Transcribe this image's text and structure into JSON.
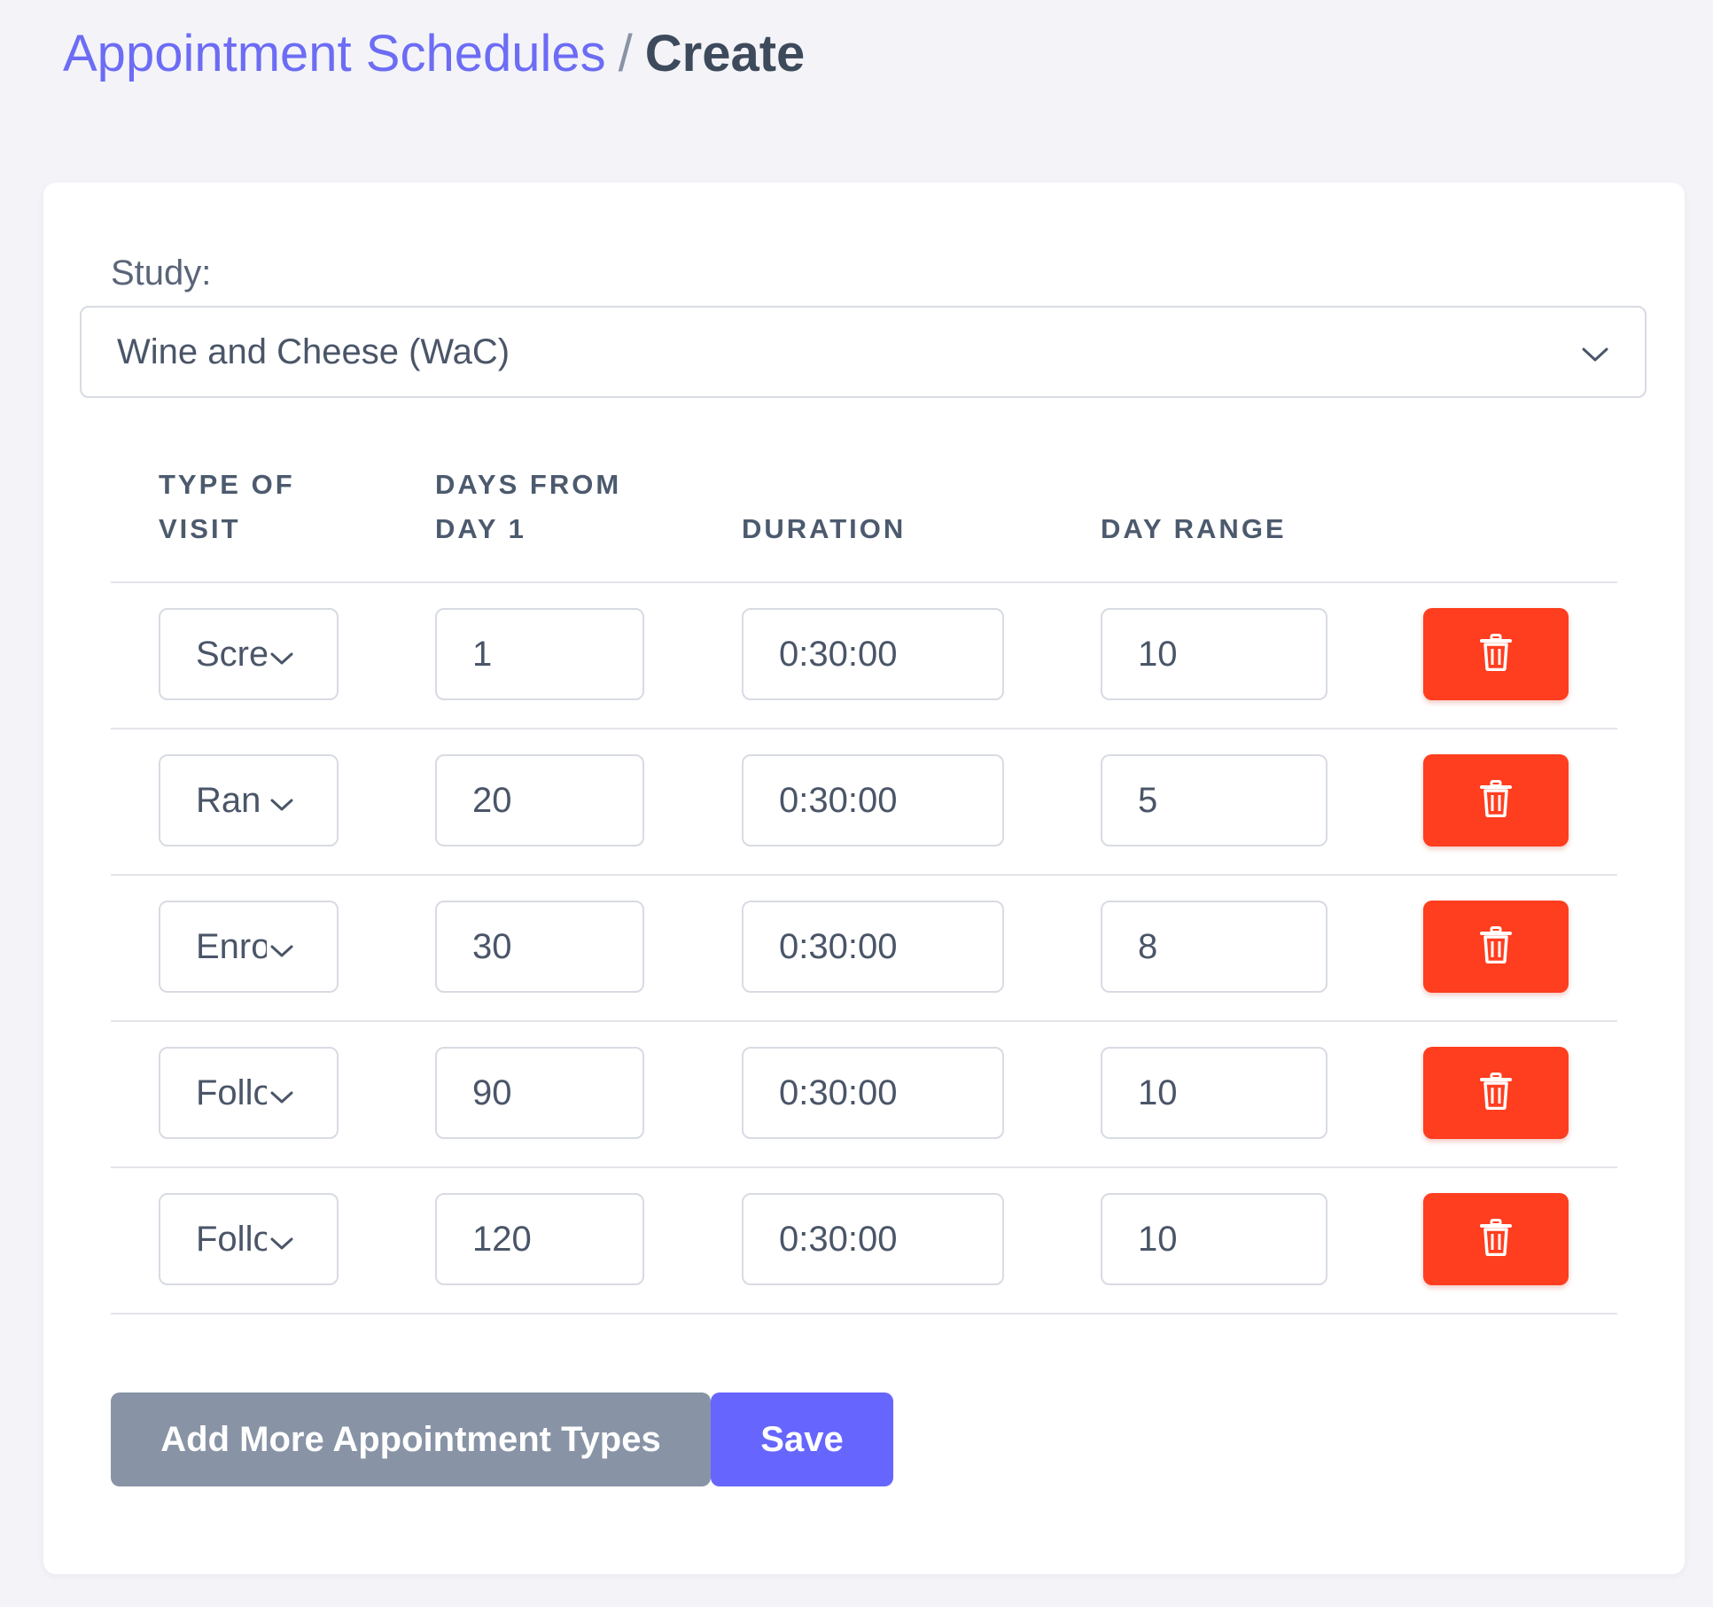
{
  "breadcrumb": {
    "parent": "Appointment Schedules",
    "separator": "/",
    "current": "Create"
  },
  "study": {
    "label": "Study:",
    "selected": "Wine and Cheese (WaC)"
  },
  "table": {
    "headers": {
      "type_line1": "TYPE OF",
      "type_line2": "VISIT",
      "days_line1": "DAYS FROM",
      "days_line2": "DAY 1",
      "duration": "DURATION",
      "day_range": "DAY RANGE"
    },
    "rows": [
      {
        "type": "Scre",
        "days": "1",
        "duration": "0:30:00",
        "range": "10"
      },
      {
        "type": "Ran",
        "days": "20",
        "duration": "0:30:00",
        "range": "5"
      },
      {
        "type": "Enro",
        "days": "30",
        "duration": "0:30:00",
        "range": "8"
      },
      {
        "type": "Follo",
        "days": "90",
        "duration": "0:30:00",
        "range": "10"
      },
      {
        "type": "Follo",
        "days": "120",
        "duration": "0:30:00",
        "range": "10"
      }
    ]
  },
  "actions": {
    "add_label": "Add More Appointment Types",
    "save_label": "Save"
  },
  "icons": {
    "delete": "trash-icon",
    "dropdown": "chevron-down-icon"
  },
  "colors": {
    "accent": "#6666ff",
    "link": "#6c6cf5",
    "danger": "#ff3d1f",
    "secondary": "#8894a6"
  }
}
